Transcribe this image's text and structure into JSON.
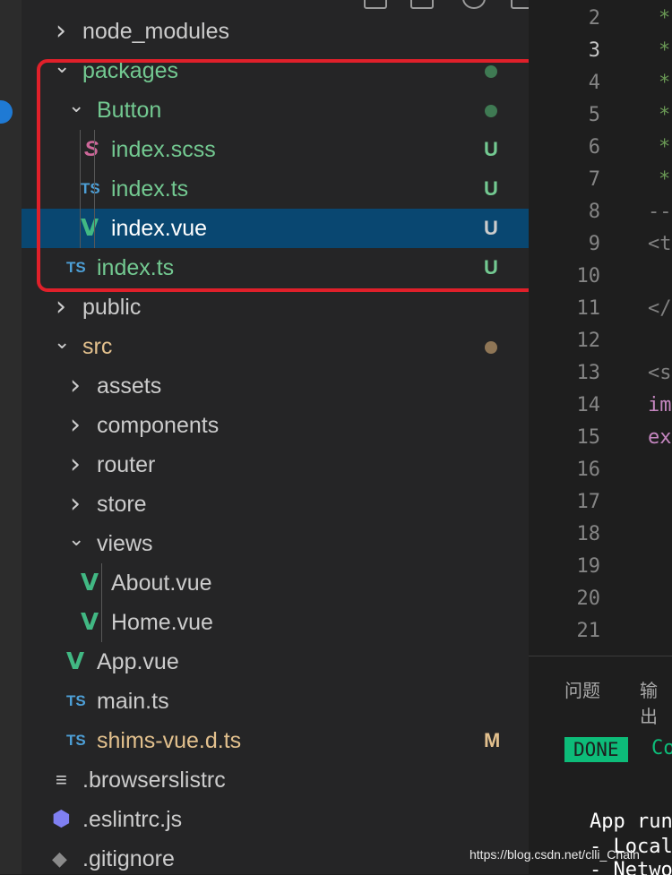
{
  "explorer": {
    "items": [
      {
        "label": "node_modules",
        "kind": "folder",
        "state": "collapsed",
        "depth": 0,
        "color": "default",
        "badge": ""
      },
      {
        "label": "packages",
        "kind": "folder",
        "state": "expanded",
        "depth": 0,
        "color": "green",
        "badge": "dot"
      },
      {
        "label": "Button",
        "kind": "folder",
        "state": "expanded",
        "depth": 1,
        "color": "green",
        "badge": "dot"
      },
      {
        "label": "index.scss",
        "kind": "file",
        "icon": "sass-icon",
        "depth": 2,
        "color": "green",
        "badge": "U"
      },
      {
        "label": "index.ts",
        "kind": "file",
        "icon": "ts-icon",
        "depth": 2,
        "color": "green",
        "badge": "U"
      },
      {
        "label": "index.vue",
        "kind": "file",
        "icon": "vue-icon",
        "depth": 2,
        "color": "white",
        "badge": "U",
        "selected": true
      },
      {
        "label": "index.ts",
        "kind": "file",
        "icon": "ts-icon",
        "depth": 1,
        "color": "green",
        "badge": "U"
      },
      {
        "label": "public",
        "kind": "folder",
        "state": "collapsed",
        "depth": 0,
        "color": "default",
        "badge": ""
      },
      {
        "label": "src",
        "kind": "folder",
        "state": "expanded",
        "depth": 0,
        "color": "orange",
        "badge": "dot"
      },
      {
        "label": "assets",
        "kind": "folder",
        "state": "collapsed",
        "depth": 1,
        "color": "default",
        "badge": ""
      },
      {
        "label": "components",
        "kind": "folder",
        "state": "collapsed",
        "depth": 1,
        "color": "default",
        "badge": ""
      },
      {
        "label": "router",
        "kind": "folder",
        "state": "collapsed",
        "depth": 1,
        "color": "default",
        "badge": ""
      },
      {
        "label": "store",
        "kind": "folder",
        "state": "collapsed",
        "depth": 1,
        "color": "default",
        "badge": ""
      },
      {
        "label": "views",
        "kind": "folder",
        "state": "expanded",
        "depth": 1,
        "color": "default",
        "badge": ""
      },
      {
        "label": "About.vue",
        "kind": "file",
        "icon": "vue-icon",
        "depth": 2,
        "color": "default",
        "badge": ""
      },
      {
        "label": "Home.vue",
        "kind": "file",
        "icon": "vue-icon",
        "depth": 2,
        "color": "default",
        "badge": ""
      },
      {
        "label": "App.vue",
        "kind": "file",
        "icon": "vue-icon",
        "depth": 1,
        "color": "default",
        "badge": ""
      },
      {
        "label": "main.ts",
        "kind": "file",
        "icon": "ts-icon",
        "depth": 1,
        "color": "default",
        "badge": ""
      },
      {
        "label": "shims-vue.d.ts",
        "kind": "file",
        "icon": "ts-icon",
        "depth": 1,
        "color": "orange",
        "badge": "M"
      },
      {
        "label": ".browserslistrc",
        "kind": "file",
        "icon": "lines-icon",
        "depth": 0,
        "color": "default",
        "badge": ""
      },
      {
        "label": ".eslintrc.js",
        "kind": "file",
        "icon": "eslint-icon",
        "depth": 0,
        "color": "default",
        "badge": ""
      },
      {
        "label": ".gitignore",
        "kind": "file",
        "icon": "git-icon",
        "depth": 0,
        "color": "default",
        "badge": ""
      }
    ]
  },
  "icons": {
    "ts": "TS",
    "vue": "V",
    "sass": "S",
    "chevron_right": "›",
    "chevron_down": "⌄"
  },
  "colors": {
    "git_added": "#73c991",
    "git_modified": "#e2c08d",
    "selection": "#094771",
    "highlight_box": "#e0202a"
  },
  "editor": {
    "line_numbers": [
      "2",
      "3",
      "4",
      "5",
      "6",
      "7",
      "8",
      "9",
      "10",
      "11",
      "12",
      "13",
      "14",
      "15",
      "16",
      "17",
      "18",
      "19",
      "20",
      "21"
    ],
    "current_line": "3",
    "code_fragments": [
      {
        "line": "2",
        "text": "*"
      },
      {
        "line": "3",
        "text": "*"
      },
      {
        "line": "4",
        "text": "*"
      },
      {
        "line": "5",
        "text": "*"
      },
      {
        "line": "6",
        "text": "*"
      },
      {
        "line": "7",
        "text": "*"
      },
      {
        "line": "8",
        "text": "--"
      },
      {
        "line": "9",
        "text": "<t"
      },
      {
        "line": "11",
        "text": "</"
      },
      {
        "line": "13",
        "text": "<s"
      },
      {
        "line": "14",
        "text": "im"
      },
      {
        "line": "15",
        "text": "ex"
      }
    ]
  },
  "panel": {
    "tabs": [
      "问题",
      "输出"
    ],
    "done_label": "DONE",
    "done_text": "Co",
    "terminal_lines": [
      "App run",
      "- Local",
      "- Netwo"
    ]
  },
  "watermark": "https://blog.csdn.net/clli_Chain"
}
